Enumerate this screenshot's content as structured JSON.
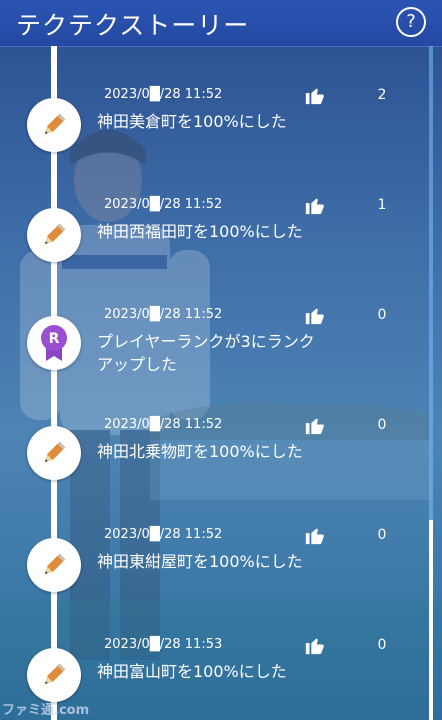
{
  "header": {
    "title": "テクテクストーリー",
    "help_label": "?"
  },
  "entries": [
    {
      "date": "2023/0█/28 11:52",
      "likes": "2",
      "text": "神田美倉町を100%にした",
      "icon": "pencil-icon"
    },
    {
      "date": "2023/0█/28 11:52",
      "likes": "1",
      "text": "神田西福田町を100%にした",
      "icon": "pencil-icon"
    },
    {
      "date": "2023/0█/28 11:52",
      "likes": "0",
      "text": "プレイヤーランクが3にランク\nアップした",
      "icon": "rank-badge-icon",
      "badge_letter": "R"
    },
    {
      "date": "2023/0█/28 11:52",
      "likes": "0",
      "text": "神田北乗物町を100%にした",
      "icon": "pencil-icon"
    },
    {
      "date": "2023/0█/28 11:52",
      "likes": "0",
      "text": "神田東紺屋町を100%にした",
      "icon": "pencil-icon"
    },
    {
      "date": "2023/0█/28 11:53",
      "likes": "0",
      "text": "神田富山町を100%にした",
      "icon": "pencil-icon"
    }
  ],
  "watermark": "ファミ通.com",
  "colors": {
    "header": "#2449a2",
    "badge": "#9a4fd0",
    "pencil": "#e08a3a"
  }
}
